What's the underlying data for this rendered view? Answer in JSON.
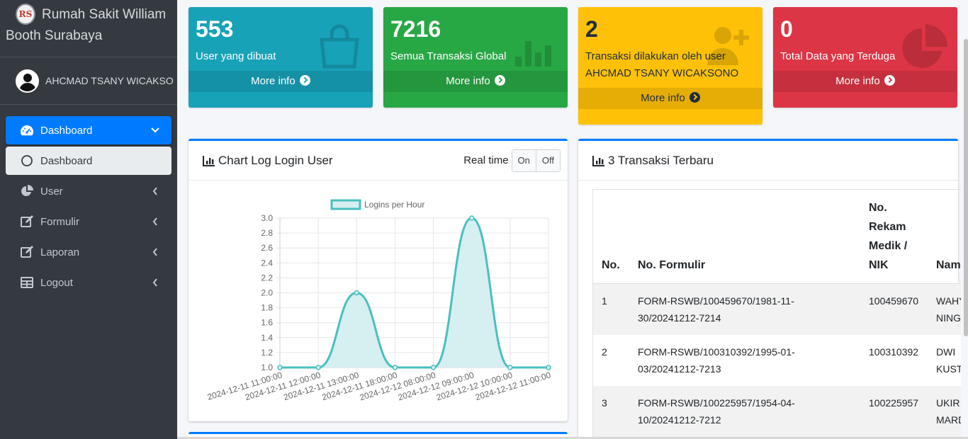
{
  "brand": {
    "title": "Rumah Sakit William Booth Surabaya",
    "logo_text": "RS"
  },
  "user": {
    "name": "AHCMAD TSANY WICAKSONO"
  },
  "nav": {
    "dashboard": "Dashboard",
    "dashboard_sub": "Dashboard",
    "user": "User",
    "formulir": "Formulir",
    "laporan": "Laporan",
    "logout": "Logout"
  },
  "boxes": [
    {
      "number": "553",
      "text": "User yang dibuat",
      "footer": "More info",
      "icon": "shopping-bag-icon"
    },
    {
      "number": "7216",
      "text": "Semua Transaksi Global",
      "footer": "More info",
      "icon": "bar-chart-icon"
    },
    {
      "number": "2",
      "text": "Transaksi dilakukan oleh user AHCMAD TSANY WICAKSONO",
      "footer": "More info",
      "icon": "user-plus-icon"
    },
    {
      "number": "0",
      "text": "Total Data yang Terduga",
      "footer": "More info",
      "icon": "pie-chart-icon"
    }
  ],
  "chart_card": {
    "title": "Chart Log Login User",
    "realtime_label": "Real time",
    "on": "On",
    "off": "Off"
  },
  "chart_data": {
    "type": "line",
    "series": [
      {
        "name": "Logins per Hour",
        "values": [
          1,
          1,
          2,
          1,
          1,
          3,
          1,
          1
        ]
      }
    ],
    "categories": [
      "2024-12-11 11:00:00",
      "2024-12-11 12:00:00",
      "2024-12-11 13:00:00",
      "2024-12-11 18:00:00",
      "2024-12-12 08:00:00",
      "2024-12-12 09:00:00",
      "2024-12-12 10:00:00",
      "2024-12-12 11:00:00"
    ],
    "yticks": [
      "1.0",
      "1.2",
      "1.4",
      "1.6",
      "1.8",
      "2.0",
      "2.2",
      "2.4",
      "2.6",
      "2.8",
      "3.0"
    ],
    "ylim": [
      1,
      3
    ],
    "legend": "top",
    "grid": true,
    "line_color": "#4bbfbf",
    "fill_color": "#d6eff1"
  },
  "table_card": {
    "title": "3 Transaksi Terbaru",
    "headers": [
      "No.",
      "No. Formulir",
      "No. Rekam Medik / NIK",
      "Nama"
    ],
    "rows": [
      {
        "no": "1",
        "form": "FORM-RSWB/100459670/1981-11-30/20241212-7214",
        "rm": "100459670",
        "nama": "WAHYU NINGSIH"
      },
      {
        "no": "2",
        "form": "FORM-RSWB/100310392/1995-01-03/20241212-7213",
        "rm": "100310392",
        "nama": "DWI KUSTINI"
      },
      {
        "no": "3",
        "form": "FORM-RSWB/100225957/1954-04-10/20241212-7212",
        "rm": "100225957",
        "nama": "UKIR MARDJI"
      }
    ]
  }
}
